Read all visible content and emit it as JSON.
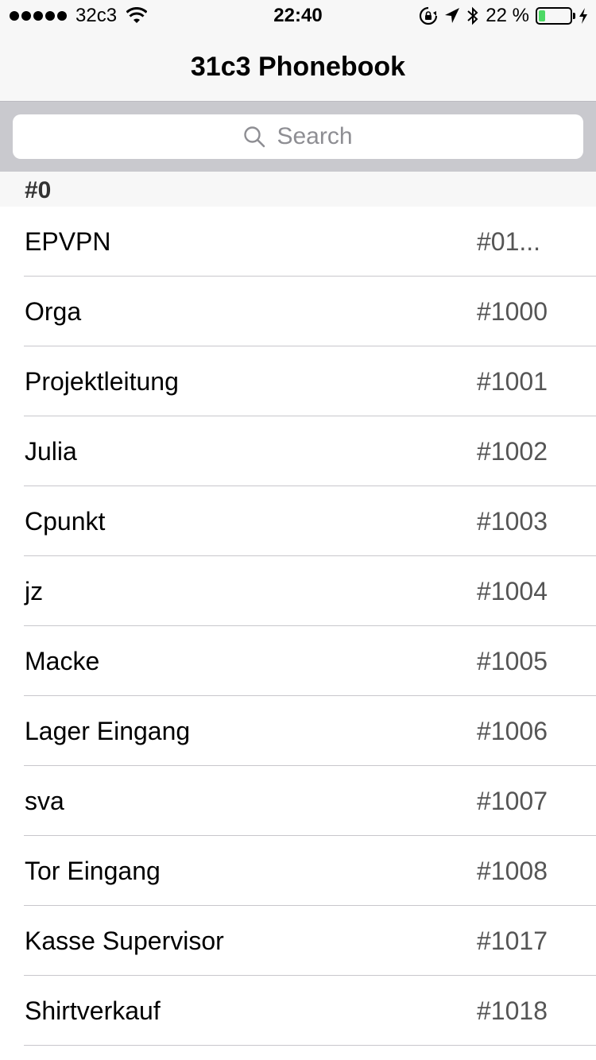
{
  "status_bar": {
    "carrier": "32c3",
    "time": "22:40",
    "battery_percent_label": "22 %",
    "battery_level": 0.22,
    "icons": [
      "signal-dots-icon",
      "wifi-icon",
      "rotation-lock-icon",
      "location-arrow-icon",
      "bluetooth-icon",
      "battery-icon",
      "charging-bolt-icon"
    ]
  },
  "nav": {
    "title": "31c3 Phonebook"
  },
  "search": {
    "placeholder": "Search"
  },
  "section": {
    "title": "#0"
  },
  "entries": [
    {
      "name": "EPVPN",
      "ext": "#01..."
    },
    {
      "name": "Orga",
      "ext": "#1000"
    },
    {
      "name": "Projektleitung",
      "ext": "#1001"
    },
    {
      "name": "Julia",
      "ext": "#1002"
    },
    {
      "name": "Cpunkt",
      "ext": "#1003"
    },
    {
      "name": "jz",
      "ext": "#1004"
    },
    {
      "name": "Macke",
      "ext": "#1005"
    },
    {
      "name": "Lager Eingang",
      "ext": "#1006"
    },
    {
      "name": "sva",
      "ext": "#1007"
    },
    {
      "name": "Tor Eingang",
      "ext": "#1008"
    },
    {
      "name": "Kasse Supervisor",
      "ext": "#1017"
    },
    {
      "name": "Shirtverkauf",
      "ext": "#1018"
    }
  ],
  "colors": {
    "accent_battery": "#4cd964",
    "placeholder": "#8e8e93",
    "extension_text": "#555555"
  }
}
